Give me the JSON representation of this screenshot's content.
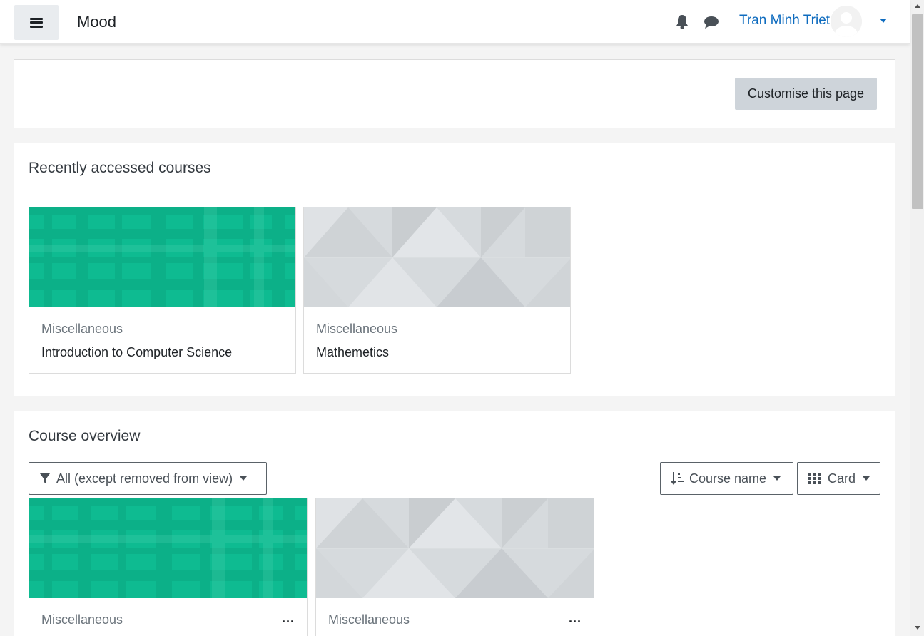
{
  "navbar": {
    "brand": "Mood",
    "user_name": "Tran Minh Triet",
    "icons": [
      "bars-icon",
      "bell-icon",
      "chat-icon",
      "avatar",
      "caret-down-icon"
    ]
  },
  "top_panel": {
    "customise_label": "Customise this page"
  },
  "recent": {
    "title": "Recently accessed courses",
    "courses": [
      {
        "category": "Miscellaneous",
        "name": "Introduction to Computer Science",
        "color": "#0ebb91"
      },
      {
        "category": "Miscellaneous",
        "name": "Mathemetics",
        "color": "#d6dadd"
      }
    ]
  },
  "overview": {
    "title": "Course overview",
    "filter_label": "All (except removed from view)",
    "sort_label": "Course name",
    "view_label": "Card",
    "courses": [
      {
        "category": "Miscellaneous",
        "menu": "..."
      },
      {
        "category": "Miscellaneous",
        "menu": "..."
      }
    ]
  },
  "colors": {
    "accent": "#0f6cbf",
    "green_pattern": "#0ebb91",
    "grey_pattern": "#d6dadd"
  }
}
